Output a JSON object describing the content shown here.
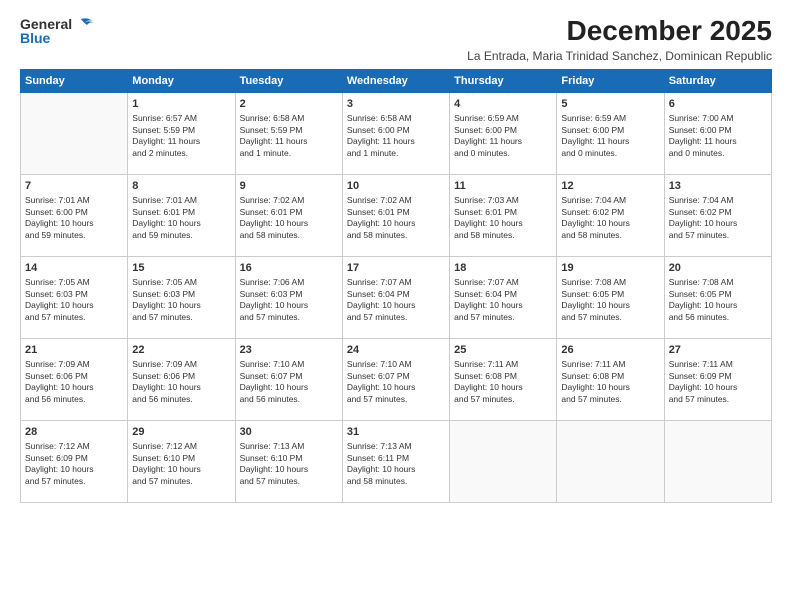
{
  "header": {
    "logo_general": "General",
    "logo_blue": "Blue",
    "title": "December 2025",
    "subtitle": "La Entrada, Maria Trinidad Sanchez, Dominican Republic"
  },
  "calendar": {
    "days_of_week": [
      "Sunday",
      "Monday",
      "Tuesday",
      "Wednesday",
      "Thursday",
      "Friday",
      "Saturday"
    ],
    "weeks": [
      [
        {
          "day": "",
          "info": ""
        },
        {
          "day": "1",
          "info": "Sunrise: 6:57 AM\nSunset: 5:59 PM\nDaylight: 11 hours\nand 2 minutes."
        },
        {
          "day": "2",
          "info": "Sunrise: 6:58 AM\nSunset: 5:59 PM\nDaylight: 11 hours\nand 1 minute."
        },
        {
          "day": "3",
          "info": "Sunrise: 6:58 AM\nSunset: 6:00 PM\nDaylight: 11 hours\nand 1 minute."
        },
        {
          "day": "4",
          "info": "Sunrise: 6:59 AM\nSunset: 6:00 PM\nDaylight: 11 hours\nand 0 minutes."
        },
        {
          "day": "5",
          "info": "Sunrise: 6:59 AM\nSunset: 6:00 PM\nDaylight: 11 hours\nand 0 minutes."
        },
        {
          "day": "6",
          "info": "Sunrise: 7:00 AM\nSunset: 6:00 PM\nDaylight: 11 hours\nand 0 minutes."
        }
      ],
      [
        {
          "day": "7",
          "info": "Sunrise: 7:01 AM\nSunset: 6:00 PM\nDaylight: 10 hours\nand 59 minutes."
        },
        {
          "day": "8",
          "info": "Sunrise: 7:01 AM\nSunset: 6:01 PM\nDaylight: 10 hours\nand 59 minutes."
        },
        {
          "day": "9",
          "info": "Sunrise: 7:02 AM\nSunset: 6:01 PM\nDaylight: 10 hours\nand 58 minutes."
        },
        {
          "day": "10",
          "info": "Sunrise: 7:02 AM\nSunset: 6:01 PM\nDaylight: 10 hours\nand 58 minutes."
        },
        {
          "day": "11",
          "info": "Sunrise: 7:03 AM\nSunset: 6:01 PM\nDaylight: 10 hours\nand 58 minutes."
        },
        {
          "day": "12",
          "info": "Sunrise: 7:04 AM\nSunset: 6:02 PM\nDaylight: 10 hours\nand 58 minutes."
        },
        {
          "day": "13",
          "info": "Sunrise: 7:04 AM\nSunset: 6:02 PM\nDaylight: 10 hours\nand 57 minutes."
        }
      ],
      [
        {
          "day": "14",
          "info": "Sunrise: 7:05 AM\nSunset: 6:03 PM\nDaylight: 10 hours\nand 57 minutes."
        },
        {
          "day": "15",
          "info": "Sunrise: 7:05 AM\nSunset: 6:03 PM\nDaylight: 10 hours\nand 57 minutes."
        },
        {
          "day": "16",
          "info": "Sunrise: 7:06 AM\nSunset: 6:03 PM\nDaylight: 10 hours\nand 57 minutes."
        },
        {
          "day": "17",
          "info": "Sunrise: 7:07 AM\nSunset: 6:04 PM\nDaylight: 10 hours\nand 57 minutes."
        },
        {
          "day": "18",
          "info": "Sunrise: 7:07 AM\nSunset: 6:04 PM\nDaylight: 10 hours\nand 57 minutes."
        },
        {
          "day": "19",
          "info": "Sunrise: 7:08 AM\nSunset: 6:05 PM\nDaylight: 10 hours\nand 57 minutes."
        },
        {
          "day": "20",
          "info": "Sunrise: 7:08 AM\nSunset: 6:05 PM\nDaylight: 10 hours\nand 56 minutes."
        }
      ],
      [
        {
          "day": "21",
          "info": "Sunrise: 7:09 AM\nSunset: 6:06 PM\nDaylight: 10 hours\nand 56 minutes."
        },
        {
          "day": "22",
          "info": "Sunrise: 7:09 AM\nSunset: 6:06 PM\nDaylight: 10 hours\nand 56 minutes."
        },
        {
          "day": "23",
          "info": "Sunrise: 7:10 AM\nSunset: 6:07 PM\nDaylight: 10 hours\nand 56 minutes."
        },
        {
          "day": "24",
          "info": "Sunrise: 7:10 AM\nSunset: 6:07 PM\nDaylight: 10 hours\nand 57 minutes."
        },
        {
          "day": "25",
          "info": "Sunrise: 7:11 AM\nSunset: 6:08 PM\nDaylight: 10 hours\nand 57 minutes."
        },
        {
          "day": "26",
          "info": "Sunrise: 7:11 AM\nSunset: 6:08 PM\nDaylight: 10 hours\nand 57 minutes."
        },
        {
          "day": "27",
          "info": "Sunrise: 7:11 AM\nSunset: 6:09 PM\nDaylight: 10 hours\nand 57 minutes."
        }
      ],
      [
        {
          "day": "28",
          "info": "Sunrise: 7:12 AM\nSunset: 6:09 PM\nDaylight: 10 hours\nand 57 minutes."
        },
        {
          "day": "29",
          "info": "Sunrise: 7:12 AM\nSunset: 6:10 PM\nDaylight: 10 hours\nand 57 minutes."
        },
        {
          "day": "30",
          "info": "Sunrise: 7:13 AM\nSunset: 6:10 PM\nDaylight: 10 hours\nand 57 minutes."
        },
        {
          "day": "31",
          "info": "Sunrise: 7:13 AM\nSunset: 6:11 PM\nDaylight: 10 hours\nand 58 minutes."
        },
        {
          "day": "",
          "info": ""
        },
        {
          "day": "",
          "info": ""
        },
        {
          "day": "",
          "info": ""
        }
      ]
    ]
  }
}
